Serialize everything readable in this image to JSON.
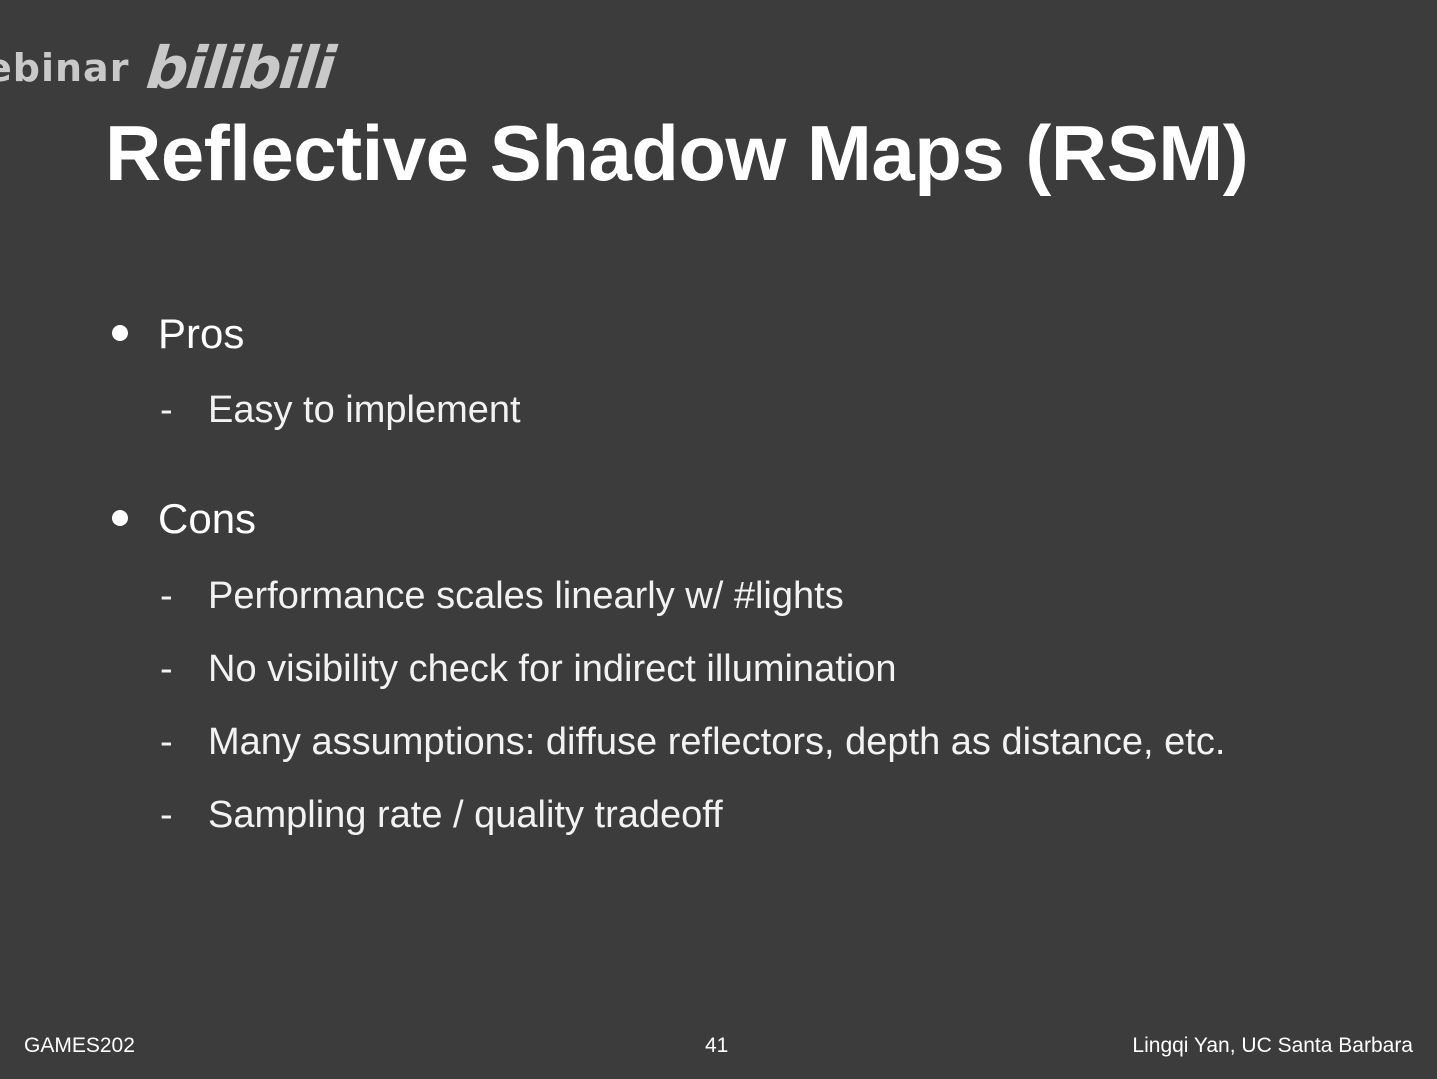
{
  "watermark": {
    "text": "ebinar",
    "logo": "bilibili"
  },
  "slide": {
    "title": "Reflective Shadow Maps (RSM)",
    "sections": [
      {
        "heading": "Pros",
        "items": [
          "Easy to implement"
        ]
      },
      {
        "heading": "Cons",
        "items": [
          "Performance scales linearly w/ #lights",
          "No visibility check for indirect illumination",
          "Many assumptions: diffuse reflectors, depth as distance, etc.",
          "Sampling rate / quality tradeoff"
        ]
      }
    ],
    "dash": "-"
  },
  "footer": {
    "left": "GAMES202",
    "center": "41",
    "right": "Lingqi Yan, UC Santa Barbara"
  },
  "colors": {
    "background": "#3c3c3c",
    "text": "#ffffff",
    "watermark": "#c9c9c9"
  }
}
